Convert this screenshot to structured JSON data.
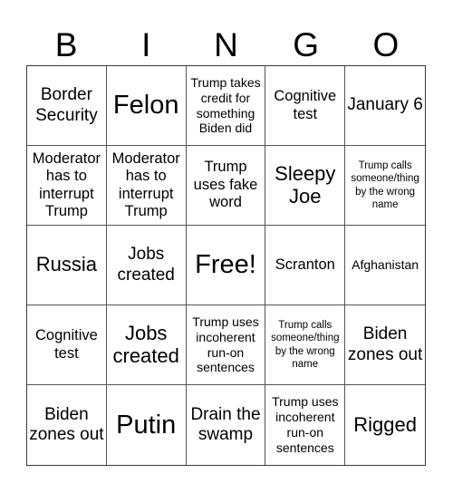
{
  "header": {
    "letters": [
      "B",
      "I",
      "N",
      "G",
      "O"
    ]
  },
  "cells": [
    "Border Security",
    "Felon",
    "Trump takes credit for something Biden did",
    "Cognitive test",
    "January 6",
    "Moderator has to interrupt Trump",
    "Moderator has to interrupt Trump",
    "Trump uses fake word",
    "Sleepy Joe",
    "Trump calls someone/thing by the wrong name",
    "Russia",
    "Jobs created",
    "Free!",
    "Scranton",
    "Afghanistan",
    "Cognitive test",
    "Jobs created",
    "Trump uses incoherent run-on sentences",
    "Trump calls someone/thing by the wrong name",
    "Biden zones out",
    "Biden zones out",
    "Putin",
    "Drain the swamp",
    "Trump uses incoherent run-on sentences",
    "Rigged"
  ]
}
